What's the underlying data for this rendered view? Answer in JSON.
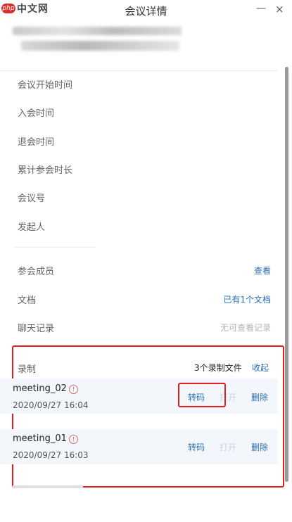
{
  "watermark": {
    "badge": "php",
    "text": "中文网"
  },
  "window": {
    "title": "会议详情",
    "minimize": "—",
    "close": "×"
  },
  "info": {
    "start_time_label": "会议开始时间",
    "join_time_label": "入会时间",
    "leave_time_label": "退会时间",
    "duration_label": "累计参会时长",
    "meeting_id_label": "会议号",
    "host_label": "发起人"
  },
  "members": {
    "label": "参会成员",
    "action": "查看"
  },
  "documents": {
    "label": "文档",
    "value": "已有1个文档"
  },
  "chat": {
    "label": "聊天记录",
    "value": "无可查看记录"
  },
  "recording": {
    "label": "录制",
    "count": "3个录制文件",
    "collapse": "收起",
    "items": [
      {
        "name": "meeting_02",
        "time": "2020/09/27 16:04",
        "convert": "转码",
        "open": "打开",
        "delete": "删除"
      },
      {
        "name": "meeting_01",
        "time": "2020/09/27 16:03",
        "convert": "转码",
        "open": "打开",
        "delete": "删除"
      }
    ]
  },
  "colors": {
    "accent": "#2a6fb5",
    "highlight": "#e02020",
    "muted": "#b4b4b4"
  }
}
